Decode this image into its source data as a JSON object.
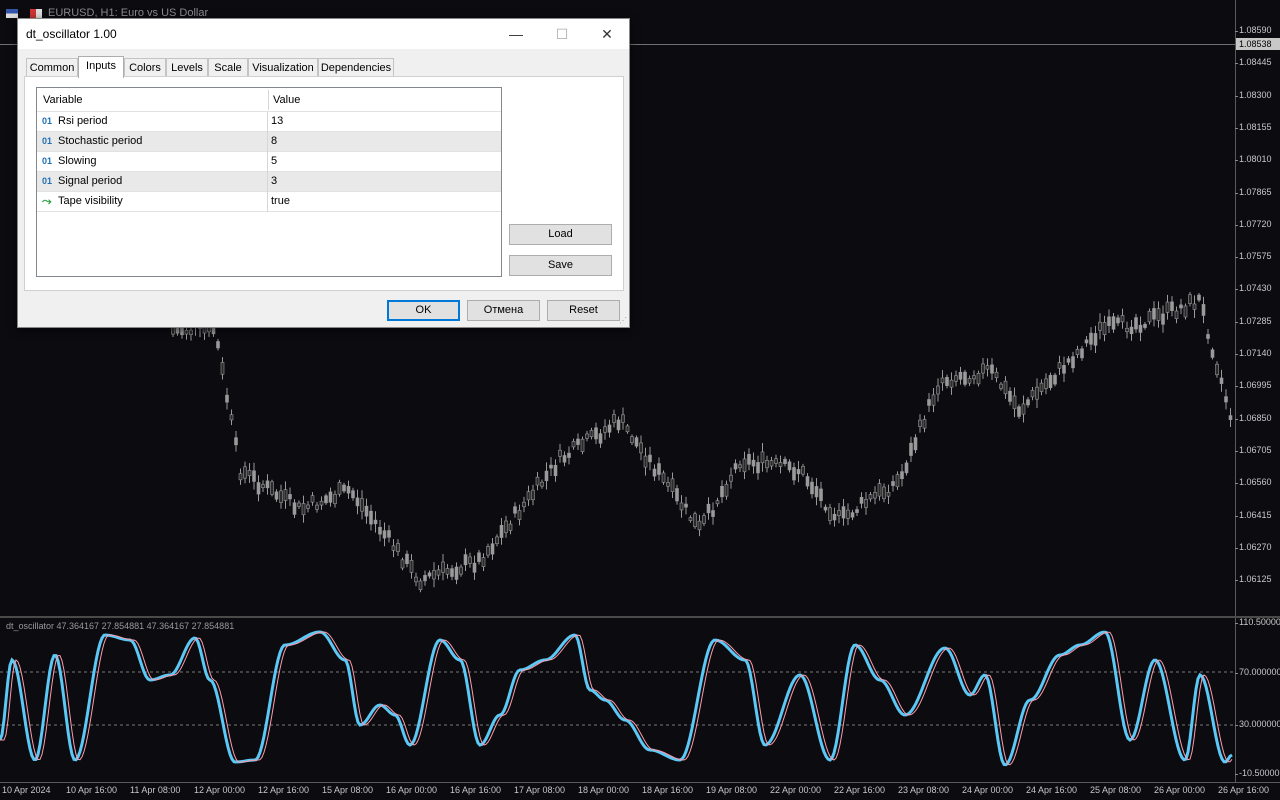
{
  "chart_window": {
    "title": "EURUSD, H1:  Euro vs US Dollar",
    "current_price": "1.08538",
    "price_ticks": [
      "1.08590",
      "1.08445",
      "1.08300",
      "1.08155",
      "1.08010",
      "1.07865",
      "1.07720",
      "1.07575",
      "1.07430",
      "1.07285",
      "1.07140",
      "1.06995",
      "1.06850",
      "1.06705",
      "1.06560",
      "1.06415",
      "1.06270",
      "1.06125"
    ],
    "indicator_label": "dt_oscillator 47.364167 27.854881 47.364167 27.854881",
    "indicator_ticks": [
      "110.50000",
      "70.000000",
      "30.000000",
      "-10.50000"
    ],
    "time_ticks": [
      "10 Apr 2024",
      "10 Apr 16:00",
      "11 Apr 08:00",
      "12 Apr 00:00",
      "12 Apr 16:00",
      "15 Apr 08:00",
      "16 Apr 00:00",
      "16 Apr 16:00",
      "17 Apr 08:00",
      "18 Apr 00:00",
      "18 Apr 16:00",
      "19 Apr 08:00",
      "22 Apr 00:00",
      "22 Apr 16:00",
      "23 Apr 08:00",
      "24 Apr 00:00",
      "24 Apr 16:00",
      "25 Apr 08:00",
      "26 Apr 00:00",
      "26 Apr 16:00"
    ],
    "colors": {
      "background": "#0b0b10",
      "candle": "#9a9a9a",
      "osc_main": "#5bc8f5",
      "osc_signal": "#ff9aa8"
    }
  },
  "dialog": {
    "title": "dt_oscillator 1.00",
    "minimize_glyph": "—",
    "maximize_glyph": "☐",
    "close_glyph": "✕",
    "tabs": [
      {
        "label": "Common",
        "active": false
      },
      {
        "label": "Inputs",
        "active": true
      },
      {
        "label": "Colors",
        "active": false
      },
      {
        "label": "Levels",
        "active": false
      },
      {
        "label": "Scale",
        "active": false
      },
      {
        "label": "Visualization",
        "active": false
      },
      {
        "label": "Dependencies",
        "active": false
      }
    ],
    "grid": {
      "header_variable": "Variable",
      "header_value": "Value",
      "rows": [
        {
          "icon": "01",
          "icon_name": "integer-icon",
          "name": "Rsi period",
          "value": "13"
        },
        {
          "icon": "01",
          "icon_name": "integer-icon",
          "name": "Stochastic period",
          "value": "8"
        },
        {
          "icon": "01",
          "icon_name": "integer-icon",
          "name": "Slowing",
          "value": "5"
        },
        {
          "icon": "01",
          "icon_name": "integer-icon",
          "name": "Signal period",
          "value": "3"
        },
        {
          "icon": "⤳",
          "icon_name": "bool-icon",
          "name": "Tape visibility",
          "value": "true"
        }
      ]
    },
    "buttons": {
      "load": "Load",
      "save": "Save",
      "ok": "OK",
      "cancel": "Отмена",
      "reset": "Reset"
    }
  }
}
